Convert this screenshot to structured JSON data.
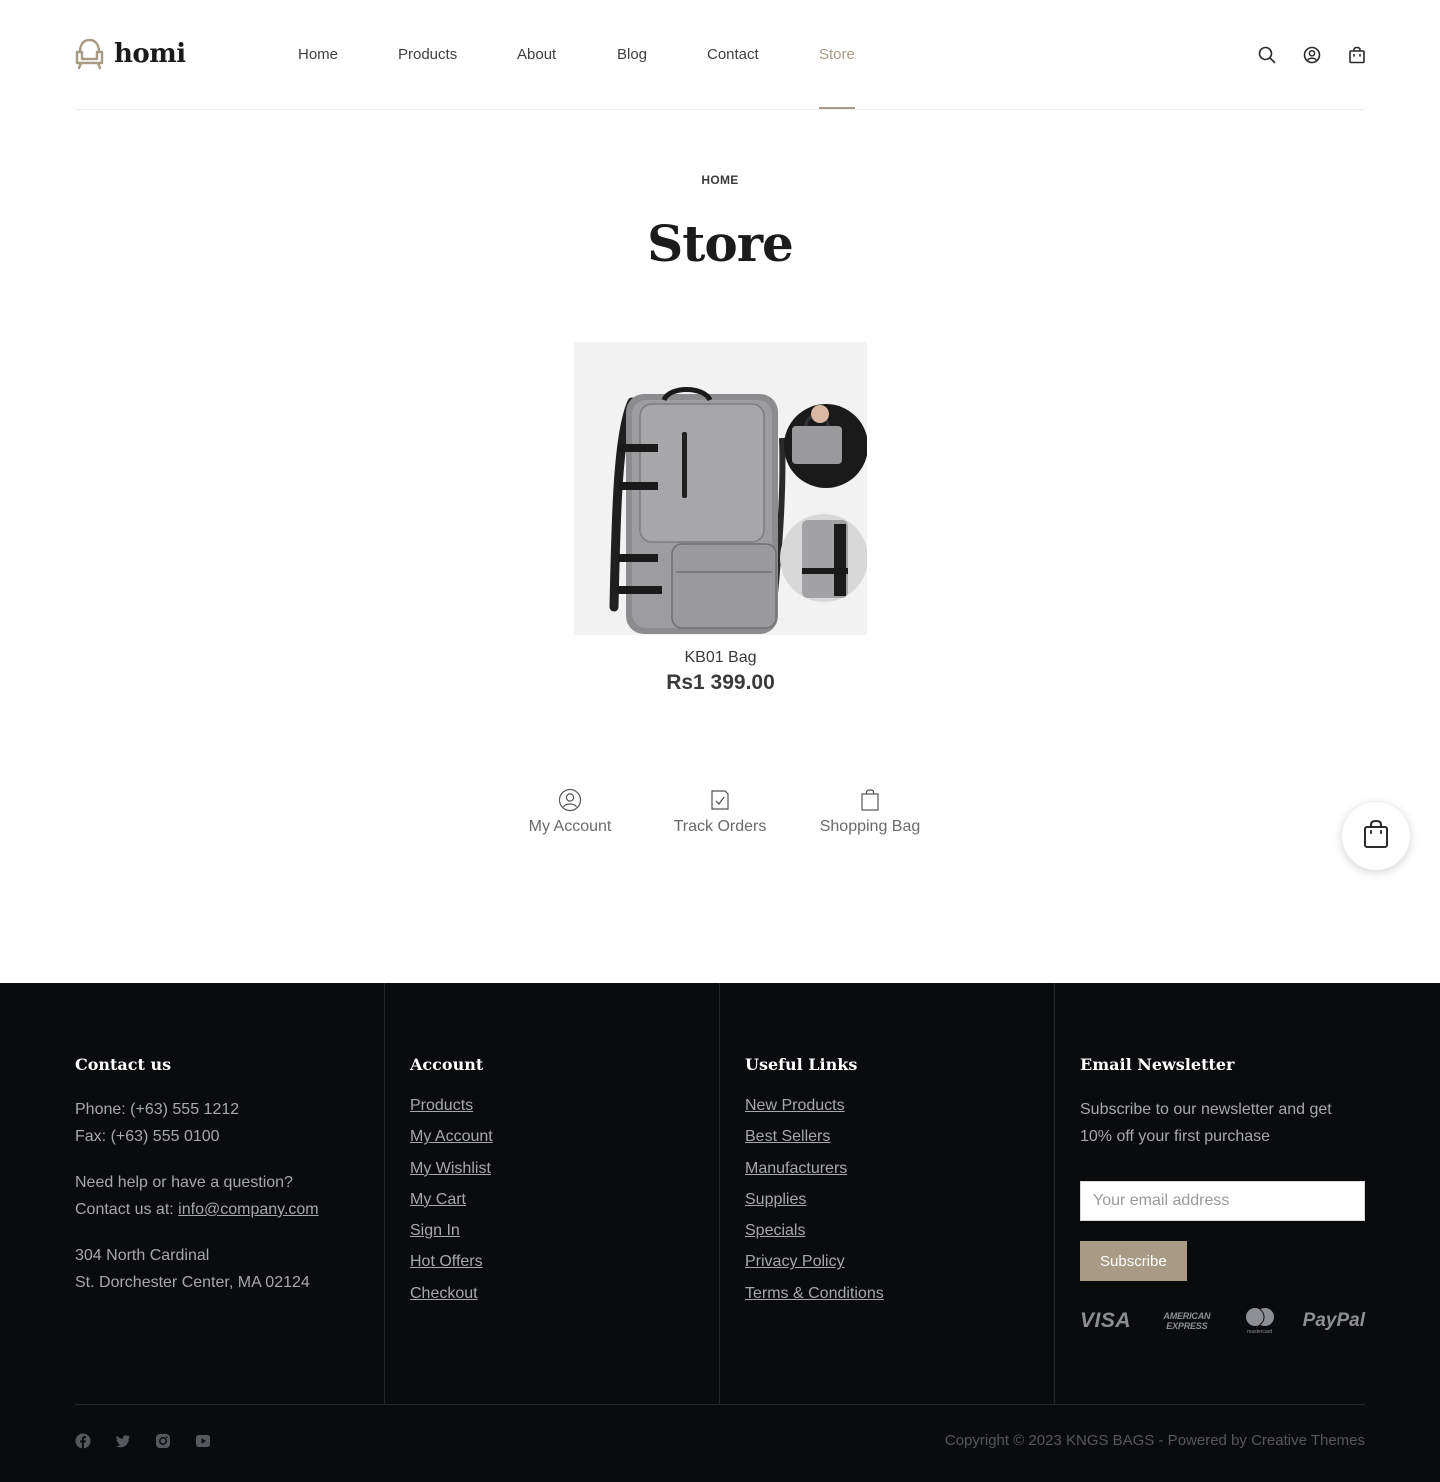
{
  "brand": {
    "name": "homi",
    "accent_color": "#a89a85"
  },
  "nav": {
    "items": [
      {
        "label": "Home"
      },
      {
        "label": "Products"
      },
      {
        "label": "About"
      },
      {
        "label": "Blog"
      },
      {
        "label": "Contact"
      },
      {
        "label": "Store",
        "active": true
      }
    ],
    "icons": [
      "search-icon",
      "user-icon",
      "bag-icon"
    ]
  },
  "breadcrumb": "HOME",
  "page_title": "Store",
  "product": {
    "name": "KB01 Bag",
    "price": "Rs1 399.00",
    "image": "grey-backpack-photo"
  },
  "quick_links": [
    {
      "label": "My Account",
      "icon": "user-circle-icon"
    },
    {
      "label": "Track Orders",
      "icon": "checklist-icon"
    },
    {
      "label": "Shopping Bag",
      "icon": "bag-icon"
    }
  ],
  "floating_cart": {
    "icon": "cart-bag-icon"
  },
  "footer": {
    "contact": {
      "title": "Contact us",
      "phone": "Phone: (+63) 555 1212",
      "fax": "Fax: (+63) 555 0100",
      "help": "Need help or have a question?",
      "contact_prefix": "Contact us at: ",
      "email": "info@company.com",
      "address1": "304 North Cardinal",
      "address2": "St. Dorchester Center, MA 02124"
    },
    "account": {
      "title": "Account",
      "links": [
        "Products",
        "My Account",
        "My Wishlist",
        "My Cart",
        "Sign In",
        "Hot Offers",
        "Checkout"
      ]
    },
    "useful": {
      "title": "Useful Links",
      "links": [
        "New Products",
        "Best Sellers",
        "Manufacturers",
        "Supplies",
        "Specials",
        "Privacy Policy",
        "Terms & Conditions"
      ]
    },
    "newsletter": {
      "title": "Email Newsletter",
      "text1": "Subscribe to our newsletter and get",
      "text2": "10% off your first purchase",
      "placeholder": "Your email address",
      "button": "Subscribe",
      "payments": [
        "VISA",
        "AMERICAN EXPRESS",
        "mastercard",
        "PayPal"
      ]
    },
    "socials": [
      "facebook-icon",
      "twitter-icon",
      "instagram-icon",
      "youtube-icon"
    ],
    "copyright": "Copyright © 2023 KNGS BAGS - Powered by Creative Themes"
  }
}
